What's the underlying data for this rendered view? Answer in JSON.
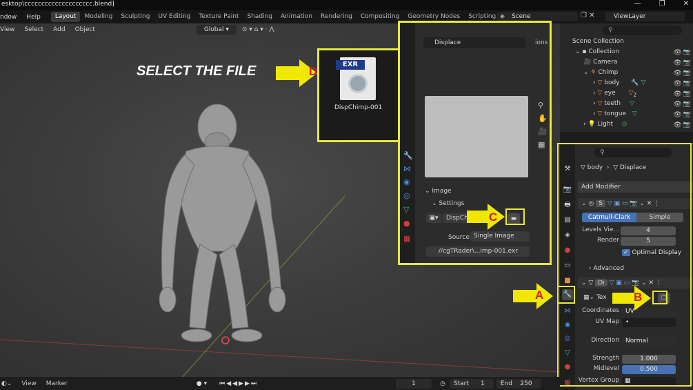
{
  "window": {
    "title": "esktop\\cccccccccccccccccccc.blend]",
    "controls": [
      "—",
      "❐",
      "✕"
    ]
  },
  "menus": [
    "ndow",
    "Help"
  ],
  "workspaces": [
    "Layout",
    "Modeling",
    "Sculpting",
    "UV Editing",
    "Texture Paint",
    "Shading",
    "Animation",
    "Rendering",
    "Compositing",
    "Geometry Nodes",
    "Scripting",
    "+"
  ],
  "scene": {
    "label": "Scene",
    "view_layer": "ViewLayer"
  },
  "viewport_header": {
    "items": [
      "View",
      "Select",
      "Add",
      "Object"
    ],
    "orientation": "Global"
  },
  "annotation": {
    "select_text": "SELECT THE FILE",
    "letters": {
      "a": "A",
      "b": "B",
      "c": "C",
      "d": "D"
    }
  },
  "outliner": {
    "rows": [
      {
        "label": "Scene Collection"
      },
      {
        "label": "Collection"
      },
      {
        "label": "Camera"
      },
      {
        "label": "Chimp"
      },
      {
        "label": "body"
      },
      {
        "label": "eye",
        "badge": "2"
      },
      {
        "label": "teeth"
      },
      {
        "label": "tongue"
      },
      {
        "label": "Light"
      }
    ]
  },
  "properties": {
    "breadcrumb_object": "body",
    "breadcrumb_modifier": "Displace",
    "add_modifier": "Add Modifier",
    "subsurf": {
      "short_name": "S",
      "tab_catmull": "Catmull-Clark",
      "tab_simple": "Simple",
      "levels_label": "Levels Vie...",
      "levels_value": "4",
      "render_label": "Render",
      "render_value": "5",
      "optimal_label": "Optimal Display",
      "advanced_label": "Advanced"
    },
    "displace": {
      "short_name": "Di",
      "texture_label": "Tex",
      "coordinates_label": "Coordinates",
      "coordinates_value": "UV",
      "uvmap_label": "UV Map",
      "uvmap_value": "•",
      "direction_label": "Direction",
      "direction_value": "Normal",
      "strength_label": "Strength",
      "strength_value": "1.000",
      "midlevel_label": "Midlevel",
      "midlevel_value": "0.500",
      "vertex_group_label": "Vertex Group"
    }
  },
  "file_panel": {
    "modifier_name": "Displace",
    "options_label": "ions",
    "image_header": "Image",
    "settings_header": "Settings",
    "image_name": "DispChim",
    "source_label": "Source",
    "source_value": "Single Image",
    "filepath": "//cgTRader\\...imp-001.exr"
  },
  "exr_popup": {
    "badge": "EXR",
    "filename": "DispChimp-001"
  },
  "timeline": {
    "items": [
      "View",
      "Marker"
    ],
    "current_frame": "1",
    "start_label": "Start",
    "start_value": "1",
    "end_label": "End",
    "end_value": "250"
  },
  "colors": {
    "annotation_yellow": "#e8e83c",
    "accent_blue": "#4772b3",
    "outliner_orange": "#e09040",
    "modifier_green": "#3fbf6f"
  }
}
